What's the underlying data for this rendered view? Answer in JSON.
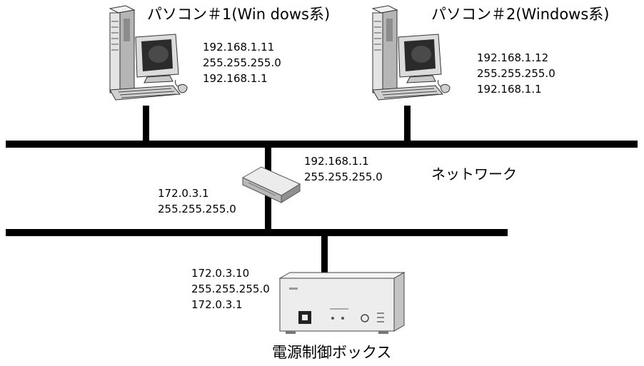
{
  "pc1": {
    "title": "パソコン＃1(Win dows系)",
    "ip": "192.168.1.11",
    "mask": "255.255.255.0",
    "gateway": "192.168.1.1"
  },
  "pc2": {
    "title": "パソコン＃2(Windows系)",
    "ip": "192.168.1.12",
    "mask": "255.255.255.0",
    "gateway": "192.168.1.1"
  },
  "router": {
    "upper_ip": "192.168.1.1",
    "upper_mask": "255.255.255.0",
    "lower_ip": "172.0.3.1",
    "lower_mask": "255.255.255.0"
  },
  "network_label": "ネットワーク",
  "power_box": {
    "ip": "172.0.3.10",
    "mask": "255.255.255.0",
    "gateway": "172.0.3.1",
    "label": "電源制御ボックス"
  },
  "colors": {
    "line": "#000000",
    "device_body": "#e6e6e6",
    "device_shade": "#a8a8a8",
    "screen": "#2b2b2b"
  },
  "icons": [
    "desktop-pc-icon",
    "router-icon",
    "power-control-box-icon"
  ]
}
